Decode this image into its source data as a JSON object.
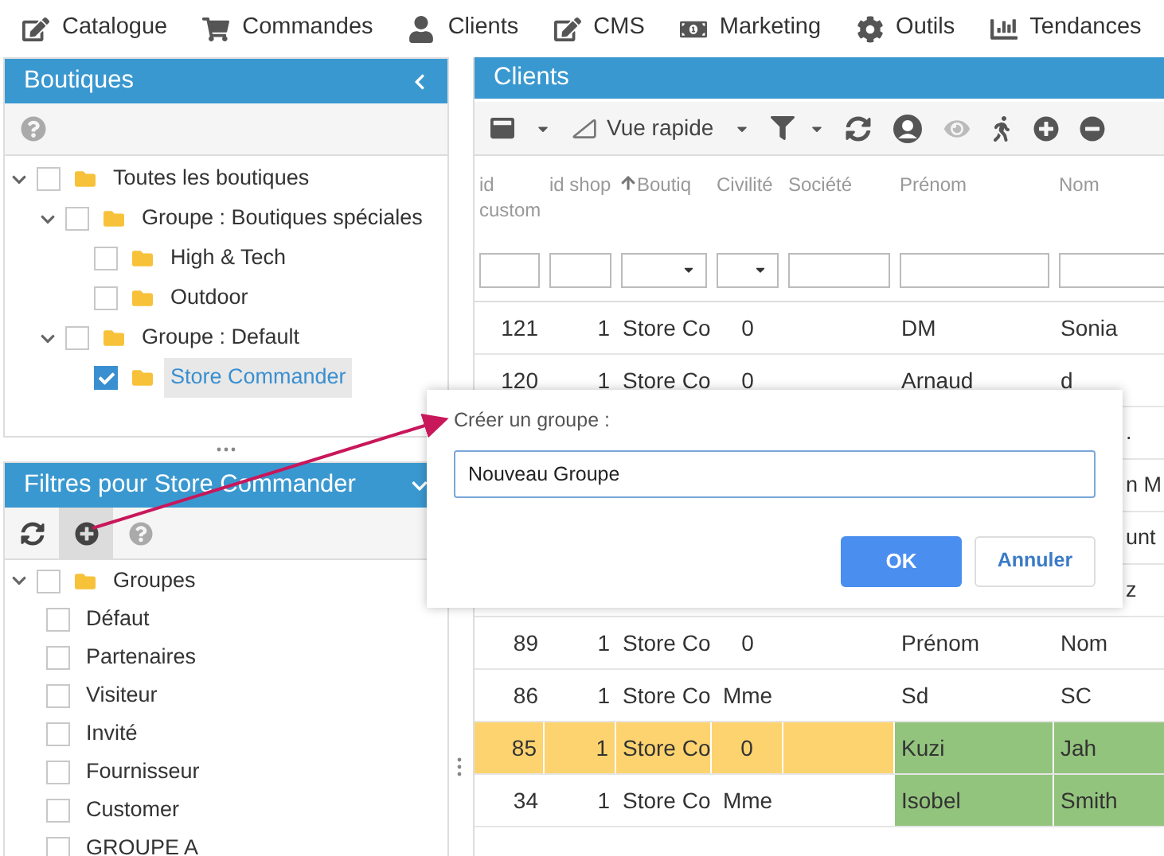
{
  "menu": [
    {
      "kind": "edit",
      "label": "Catalogue"
    },
    {
      "kind": "cart",
      "label": "Commandes"
    },
    {
      "kind": "user",
      "label": "Clients"
    },
    {
      "kind": "edit",
      "label": "CMS"
    },
    {
      "kind": "money",
      "label": "Marketing"
    },
    {
      "kind": "gear",
      "label": "Outils"
    },
    {
      "kind": "chart",
      "label": "Tendances"
    }
  ],
  "shops_panel": {
    "title": "Boutiques",
    "tree": [
      {
        "label": "Toutes les boutiques",
        "expanded": true,
        "checked": false,
        "selected": false,
        "children": [
          {
            "label": "Groupe : Boutiques spéciales",
            "expanded": true,
            "checked": false,
            "selected": false,
            "children": [
              {
                "label": "High & Tech",
                "checked": false,
                "selected": false
              },
              {
                "label": "Outdoor",
                "checked": false,
                "selected": false
              }
            ]
          },
          {
            "label": "Groupe : Default",
            "expanded": true,
            "checked": false,
            "selected": false,
            "children": [
              {
                "label": "Store Commander",
                "checked": true,
                "selected": true
              }
            ]
          }
        ]
      }
    ]
  },
  "filters_panel": {
    "title": "Filtres pour Store Commander",
    "tree": [
      {
        "label": "Groupes",
        "kind": "folder",
        "expanded": true,
        "checked": false,
        "children": [
          {
            "label": "Défaut",
            "kind": "item",
            "checked": false
          },
          {
            "label": "Partenaires",
            "kind": "item",
            "checked": false
          },
          {
            "label": "Visiteur",
            "kind": "item",
            "checked": false
          },
          {
            "label": "Invité",
            "kind": "item",
            "checked": false
          },
          {
            "label": "Fournisseur",
            "kind": "item",
            "checked": false
          },
          {
            "label": "Customer",
            "kind": "item",
            "checked": false
          },
          {
            "label": "GROUPE A",
            "kind": "item",
            "checked": false
          }
        ]
      }
    ]
  },
  "clients_panel": {
    "title": "Clients",
    "view": "Vue rapide",
    "columns": [
      {
        "label": "id custom",
        "kind": "text",
        "sorted": false
      },
      {
        "label": "id shop",
        "kind": "text",
        "sorted": false
      },
      {
        "label": "Boutiq",
        "kind": "select",
        "sorted": true
      },
      {
        "label": "Civilité",
        "kind": "select",
        "sorted": false
      },
      {
        "label": "Société",
        "kind": "text",
        "sorted": false
      },
      {
        "label": "Prénom",
        "kind": "text",
        "sorted": false
      },
      {
        "label": "Nom",
        "kind": "text",
        "sorted": false
      }
    ],
    "rows": [
      {
        "kind": "record",
        "cells": [
          "121",
          "1",
          "Store Co",
          "0",
          "",
          "DM",
          "Sonia"
        ],
        "selected": false,
        "highlighted": false
      },
      {
        "kind": "record",
        "cells": [
          "120",
          "1",
          "Store Co",
          "0",
          "",
          "Arnaud",
          "d"
        ],
        "selected": false,
        "highlighted": false
      },
      {
        "kind": "covered",
        "fragment": "."
      },
      {
        "kind": "covered",
        "fragment": "n M"
      },
      {
        "kind": "covered",
        "fragment": "unt"
      },
      {
        "kind": "covered",
        "fragment": "z"
      },
      {
        "kind": "record",
        "cells": [
          "89",
          "1",
          "Store Co",
          "0",
          "",
          "Prénom",
          "Nom"
        ],
        "selected": false,
        "highlighted": false
      },
      {
        "kind": "record",
        "cells": [
          "86",
          "1",
          "Store Co",
          "Mme",
          "",
          "Sd",
          "SC"
        ],
        "selected": false,
        "highlighted": false
      },
      {
        "kind": "record",
        "cells": [
          "85",
          "1",
          "Store Co",
          "0",
          "",
          "Kuzi",
          "Jah"
        ],
        "selected": true,
        "highlighted": true
      },
      {
        "kind": "record",
        "cells": [
          "34",
          "1",
          "Store Co",
          "Mme",
          "",
          "Isobel",
          "Smith"
        ],
        "selected": false,
        "highlighted": true
      }
    ]
  },
  "dialog": {
    "label": "Créer un groupe :",
    "value": "Nouveau Groupe",
    "ok": "OK",
    "cancel": "Annuler"
  }
}
